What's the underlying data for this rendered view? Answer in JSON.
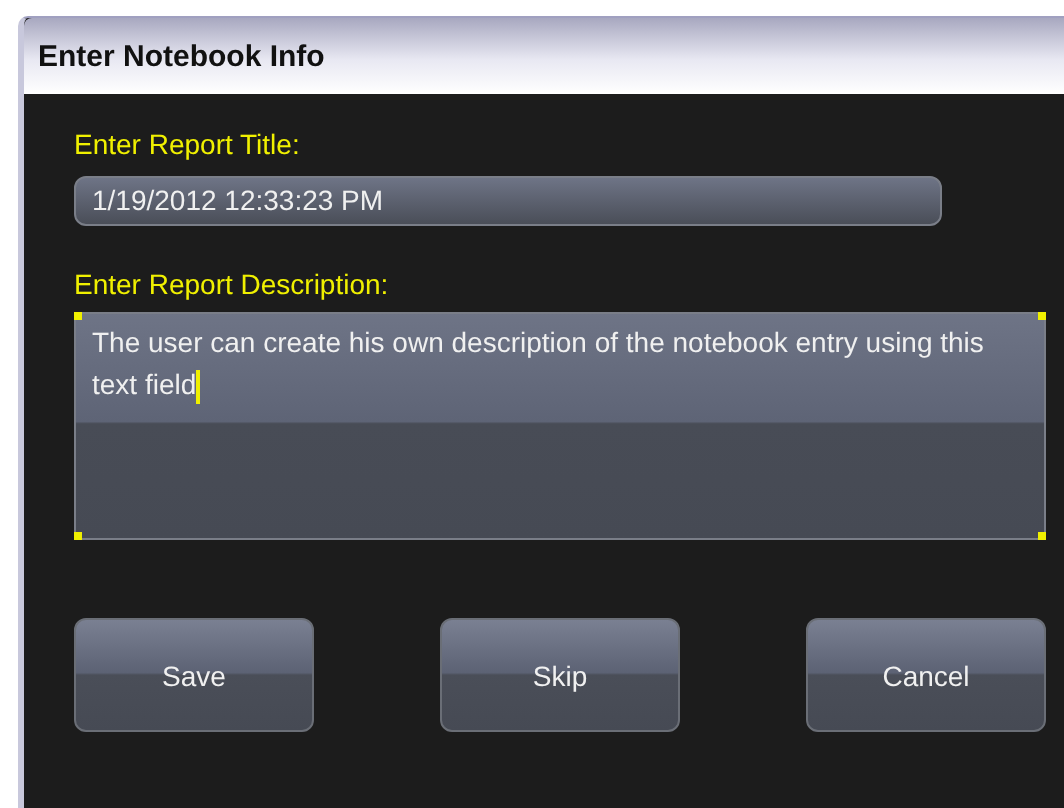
{
  "window": {
    "title": "Enter Notebook Info"
  },
  "fields": [
    {
      "kind": "line",
      "label": "Enter Report Title:",
      "value": "1/19/2012 12:33:23 PM",
      "focused": false
    },
    {
      "kind": "area",
      "label": "Enter Report Description:",
      "value": "The user can create his own description of the notebook entry using this text field",
      "focused": true
    }
  ],
  "buttons": [
    "Save",
    "Skip",
    "Cancel"
  ]
}
